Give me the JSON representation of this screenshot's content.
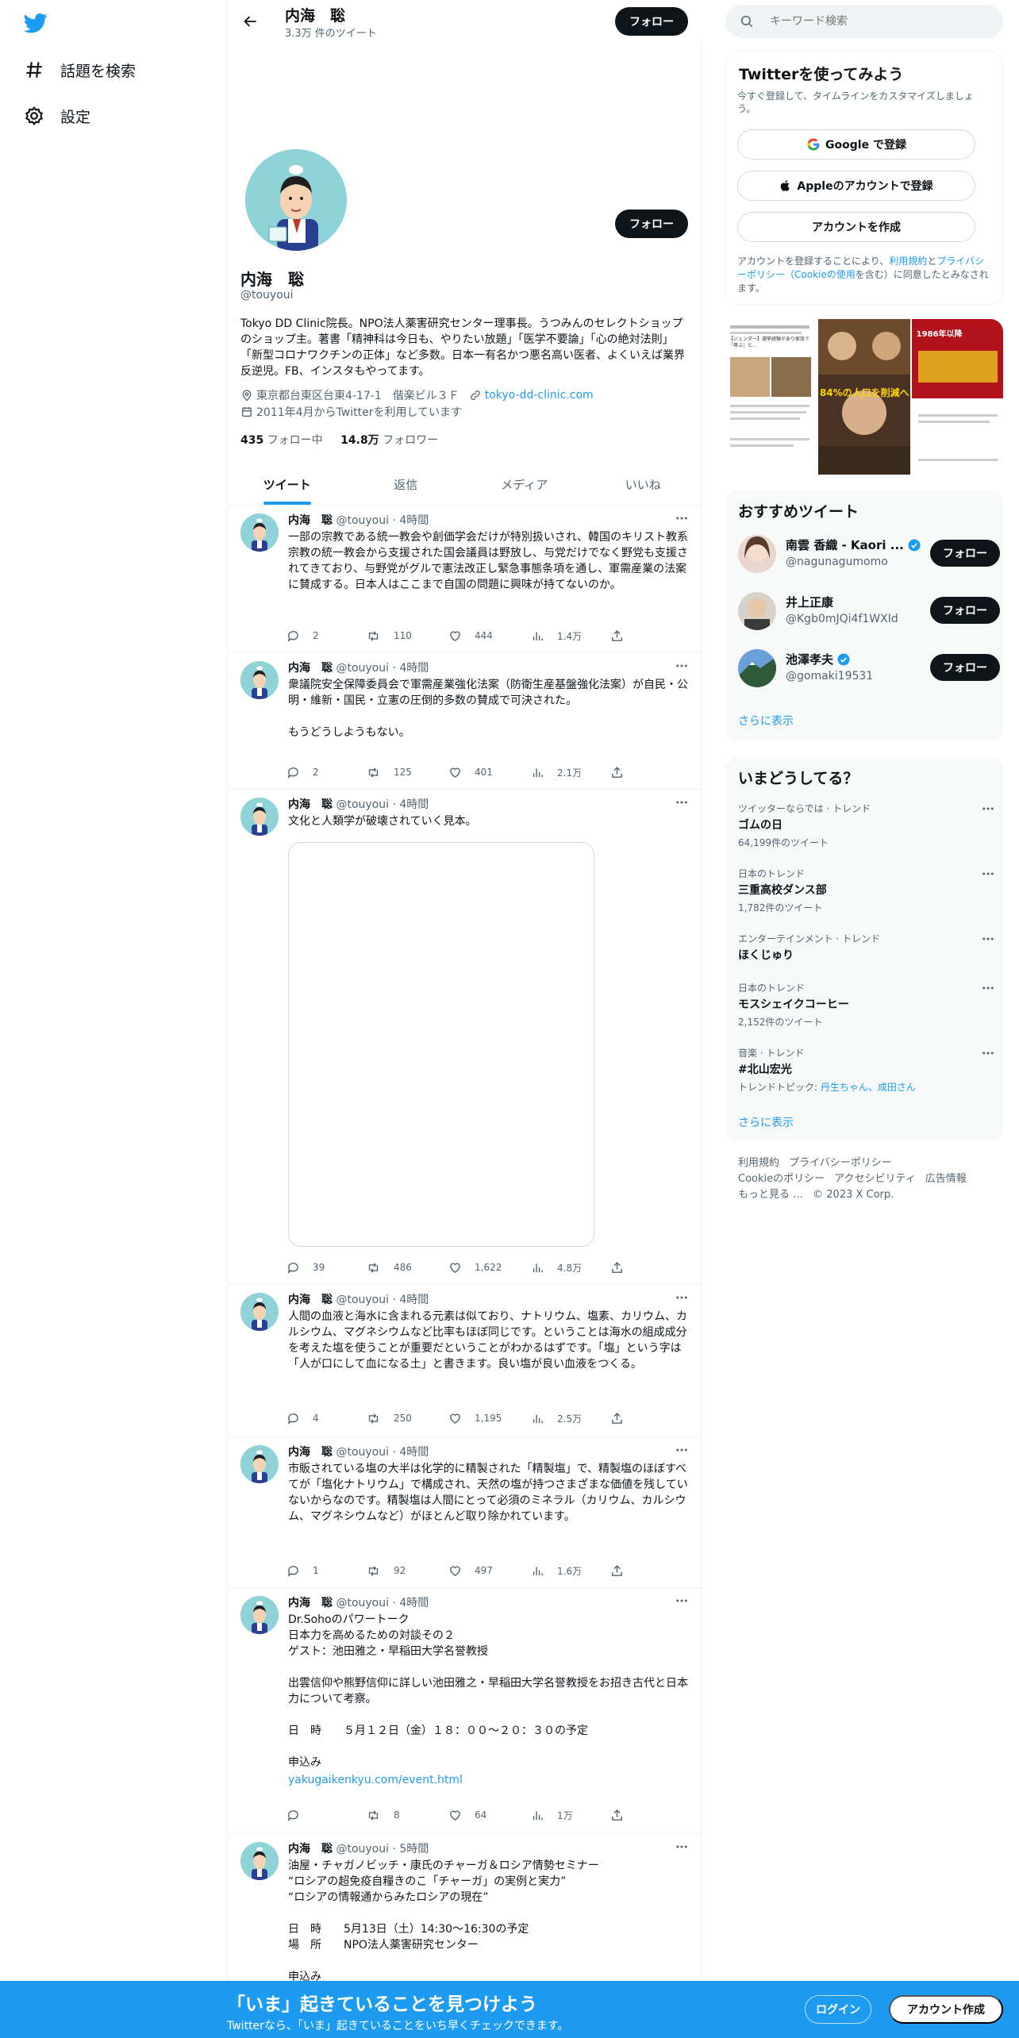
{
  "nav": {
    "logo_icon": "twitter-bird-icon",
    "explore": "話題を検索",
    "settings": "設定"
  },
  "header": {
    "name": "内海　聡",
    "tweet_count": "3.3万 件のツイート",
    "follow": "フォロー"
  },
  "profile": {
    "name": "内海　聡",
    "handle": "@touyoui",
    "follow": "フォロー",
    "bio": "Tokyo DD Clinic院長。NPO法人薬害研究センター理事長。うつみんのセレクトショップのショップ主。著書「精神科は今日も、やりたい放題」「医学不要論」「心の絶対法則」「新型コロナワクチンの正体」など多数。日本一有名かつ悪名高い医者、よくいえば業界反逆児。FB、インスタもやってます。",
    "location": "東京都台東区台東4-17-1　偕楽ビル３Ｆ",
    "website": "tokyo-dd-clinic.com",
    "joined": "2011年4月からTwitterを利用しています",
    "following_count": "435",
    "following_label": "フォロー中",
    "followers_count": "14.8万",
    "followers_label": "フォロワー"
  },
  "tabs": [
    "ツイート",
    "返信",
    "メディア",
    "いいね"
  ],
  "tweets": [
    {
      "name": "内海　聡",
      "meta": "@touyoui · 4時間",
      "text": "一部の宗教である統一教会や創価学会だけが特別扱いされ、韓国のキリスト教系宗教の統一教会から支援された国会議員は野放し、与党だけでなく野党も支援されてきており、与野党がグルで憲法改正し緊急事態条項を通し、軍需産業の法案に賛成する。日本人はここまで自国の問題に興味が持てないのか。",
      "replies": "2",
      "retweets": "110",
      "likes": "444",
      "views": "1.4万"
    },
    {
      "name": "内海　聡",
      "meta": "@touyoui · 4時間",
      "text": "衆議院安全保障委員会で軍需産業強化法案（防衛生産基盤強化法案）が自民・公明・維新・国民・立憲の圧倒的多数の賛成で可決された。\n\nもうどうしようもない。",
      "replies": "2",
      "retweets": "125",
      "likes": "401",
      "views": "2.1万"
    },
    {
      "name": "内海　聡",
      "meta": "@touyoui · 4時間",
      "text": "文化と人類学が破壊されていく見本。",
      "replies": "39",
      "retweets": "486",
      "likes": "1,622",
      "views": "4.8万"
    },
    {
      "name": "内海　聡",
      "meta": "@touyoui · 4時間",
      "text": "人間の血液と海水に含まれる元素は似ており、ナトリウム、塩素、カリウム、カルシウム、マグネシウムなど比率もほぼ同じです。ということは海水の組成成分を考えた塩を使うことが重要だということがわかるはずです。「塩」という字は「人が口にして血になる土」と書きます。良い塩が良い血液をつくる。",
      "replies": "4",
      "retweets": "250",
      "likes": "1,195",
      "views": "2.5万"
    },
    {
      "name": "内海　聡",
      "meta": "@touyoui · 4時間",
      "text": "市販されている塩の大半は化学的に精製された「精製塩」で、精製塩のほぼすべてが「塩化ナトリウム」で構成され、天然の塩が持つさまざまな価値を残していないからなのです。精製塩は人間にとって必須のミネラル（カリウム、カルシウム、マグネシウムなど）がほとんど取り除かれています。",
      "replies": "1",
      "retweets": "92",
      "likes": "497",
      "views": "1.6万"
    },
    {
      "name": "内海　聡",
      "meta": "@touyoui · 4時間",
      "text": "Dr.Sohoのパワートーク\n日本力を高めるための対談その２\nゲスト：池田雅之・早稲田大学名誉教授\n\n出雲信仰や熊野信仰に詳しい池田雅之・早稲田大学名誉教授をお招き古代と日本力について考察。\n\n日　時　　５月１２日（金）１８：００～２０：３０の予定\n\n申込み",
      "link": "yakugaikenkyu.com/event.html",
      "replies": "",
      "retweets": "8",
      "likes": "64",
      "views": "1万"
    },
    {
      "name": "内海　聡",
      "meta": "@touyoui · 5時間",
      "text": "油屋・チャガノビッチ・康氏のチャーガ＆ロシア情勢セミナー\n“ロシアの超免疫自糧きのこ「チャーガ」の実例と実力”\n“ロシアの情報通からみたロシアの現在”\n\n日　時　　5月13日（土）14:30～16:30の予定\n場　所　　NPO法人薬害研究センター\n\n申込み"
    }
  ],
  "search": {
    "placeholder": "キーワード検索",
    "icon": "search-icon"
  },
  "signup_card": {
    "title": "Twitterを使ってみよう",
    "subtitle": "今すぐ登録して、タイムラインをカスタマイズしましょう。",
    "google": "Google で登録",
    "apple": "Appleのアカウントで登録",
    "create": "アカウントを作成",
    "legal_pre": "アカウントを登録することにより、",
    "legal_terms": "利用規約",
    "legal_and": "と",
    "legal_privacy": "プライバシーポリシー",
    "legal_cookie": "（Cookieの使用",
    "legal_post": "を含む）に同意したとみなされます。"
  },
  "thumbs": {
    "t1": "【ジェンダー】選挙経験があり家族で「尊ぶ」と…",
    "t2": "84%の人口を削減へ",
    "t3": "1986年以降"
  },
  "recommended": {
    "title": "おすすめツイート",
    "users": [
      {
        "name": "南雲 香織 - Kaori ...",
        "handle": "@nagunagumomo",
        "follow": "フォロー"
      },
      {
        "name": "井上正康",
        "handle": "@Kgb0mJQi4f1WXId",
        "follow": "フォロー"
      },
      {
        "name": "池澤孝夫",
        "handle": "@gomaki19531",
        "follow": "フォロー"
      }
    ],
    "more": "さらに表示"
  },
  "trends": {
    "title": "いまどうしてる？",
    "items": [
      {
        "context": "ツイッターならでは · トレンド",
        "topic": "ゴムの日",
        "count": "64,199件のツイート"
      },
      {
        "context": "日本のトレンド",
        "topic": "三重高校ダンス部",
        "count": "1,782件のツイート"
      },
      {
        "context": "エンターテインメント · トレンド",
        "topic": "ほくじゅり",
        "count": ""
      },
      {
        "context": "日本のトレンド",
        "topic": "モスシェイクコーヒー",
        "count": "2,152件のツイート"
      },
      {
        "context": "音楽 · トレンド",
        "topic": "#北山宏光",
        "count_pre": "トレンドトピック: ",
        "count_link": "丹生ちゃん、成田さん"
      }
    ],
    "more": "さらに表示"
  },
  "footer": {
    "terms": "利用規約",
    "privacy": "プライバシーポリシー",
    "cookie": "Cookieのポリシー",
    "a11y": "アクセシビリティ",
    "ads": "広告情報",
    "more": "もっと見る …",
    "copyright": "© 2023 X Corp."
  },
  "bottombar": {
    "title": "「いま」起きていることを見つけよう",
    "subtitle": "Twitterなら、「いま」起きていることをいち早くチェックできます。",
    "login": "ログイン",
    "signup": "アカウント作成"
  },
  "colors": {
    "accent": "#1d9bf0",
    "text": "#0f1419",
    "muted": "#536471"
  }
}
